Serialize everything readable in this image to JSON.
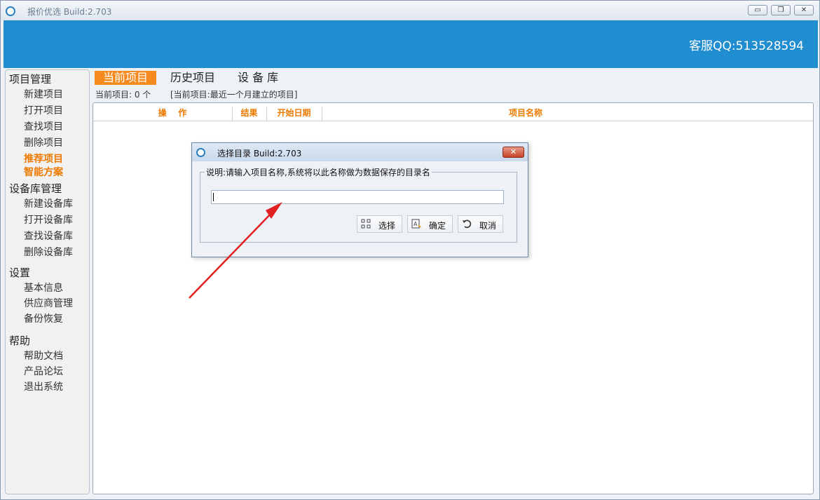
{
  "window": {
    "title": "报价优选   Build:2.703",
    "minimize": "▭",
    "restore": "❐",
    "close": "✕"
  },
  "banner": {
    "service_qq": "客服QQ:513528594"
  },
  "sidebar": {
    "groups": [
      {
        "label": "项目管理",
        "items": [
          "新建项目",
          "打开项目",
          "查找项目",
          "删除项目"
        ]
      },
      {
        "label": "设备库管理",
        "items": [
          "新建设备库",
          "打开设备库",
          "查找设备库",
          "删除设备库"
        ]
      },
      {
        "label": "设置",
        "items": [
          "基本信息",
          "供应商管理",
          "备份恢复"
        ]
      },
      {
        "label": "帮助",
        "items": [
          "帮助文档",
          "产品论坛",
          "退出系统"
        ]
      }
    ],
    "highlights": [
      "推荐项目",
      "智能方案"
    ]
  },
  "tabs": [
    "当前项目",
    "历史项目",
    "设 备 库"
  ],
  "info": {
    "count": "当前项目: 0 个",
    "note": "[当前项目:最近一个月建立的项目]"
  },
  "table": {
    "columns": [
      "操    作",
      "结果",
      "开始日期",
      "项目名称"
    ]
  },
  "dialog": {
    "title": "选择目录   Build:2.703",
    "close": "✕",
    "legend": "说明:请输入项目名称,系统将以此名称做为数据保存的目录名",
    "input_value": "",
    "buttons": {
      "select": "选择",
      "ok": "确定",
      "cancel": "取消"
    }
  },
  "colors": {
    "banner": "#1f8dd0",
    "accent": "#f58b1f",
    "arrow": "#e02020"
  }
}
